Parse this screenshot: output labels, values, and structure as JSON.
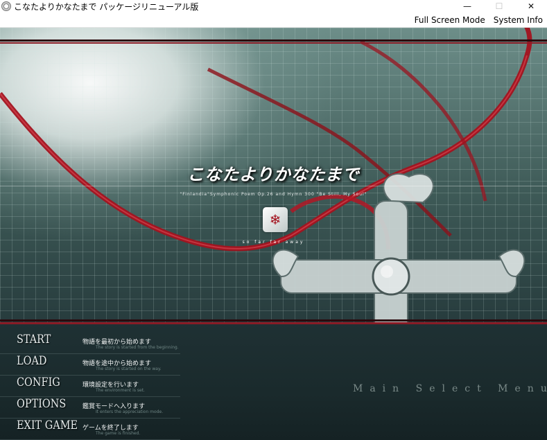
{
  "window": {
    "title": "こなたよりかなたまで パッケージリニューアル版",
    "app_icon": "game-emblem-icon",
    "controls": {
      "minimize": "—",
      "maximize": "☐",
      "close": "✕"
    }
  },
  "menubar": {
    "items": [
      {
        "label": "Full Screen Mode"
      },
      {
        "label": "System Info"
      }
    ]
  },
  "game": {
    "title": "こなたよりかなたまで",
    "subtitle": "\"Finlandia\"Symphonic Poem Op.26 and Hymn 300 \"Be Still, My Soul\"",
    "tagline": "so far  far away",
    "background_text": "Main Select Menu",
    "accent_color": "#8a1b25",
    "menu": [
      {
        "label": "START",
        "desc": "物語を最初から始めます",
        "sub": "The story is started from the beginning."
      },
      {
        "label": "LOAD",
        "desc": "物語を途中から始めます",
        "sub": "The story is started on the way."
      },
      {
        "label": "CONFIG",
        "desc": "環境設定を行います",
        "sub": "The environment is set."
      },
      {
        "label": "OPTIONS",
        "desc": "鑑賞モードへ入ります",
        "sub": "It enters the appreciation mode."
      },
      {
        "label": "EXIT GAME",
        "desc": "ゲームを終了します",
        "sub": "The game is finished."
      }
    ]
  }
}
